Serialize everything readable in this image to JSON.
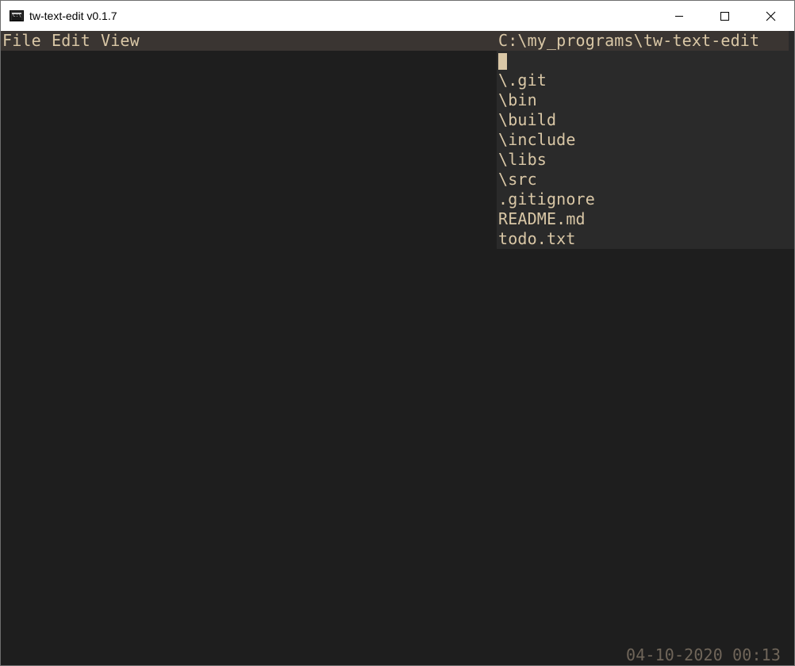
{
  "window": {
    "title": "tw-text-edit v0.1.7",
    "icon": "console-app-icon",
    "controls": [
      "minimize-icon",
      "maximize-icon",
      "close-icon"
    ]
  },
  "menubar": {
    "items": [
      {
        "label": "File"
      },
      {
        "label": "Edit"
      },
      {
        "label": "View"
      }
    ]
  },
  "explorer": {
    "path": "C:\\my_programs\\tw-text-edit",
    "entries": [
      "\\.git",
      "\\bin",
      "\\build",
      "\\include",
      "\\libs",
      "\\src",
      ".gitignore",
      "README.md",
      "todo.txt"
    ]
  },
  "status": {
    "datetime": "04-10-2020 00:13"
  },
  "colors": {
    "background": "#1e1e1e",
    "menubar": "#3a3532",
    "panel": "#2a2a2a",
    "text": "#d9c7a6",
    "status_text": "#6f6559"
  }
}
